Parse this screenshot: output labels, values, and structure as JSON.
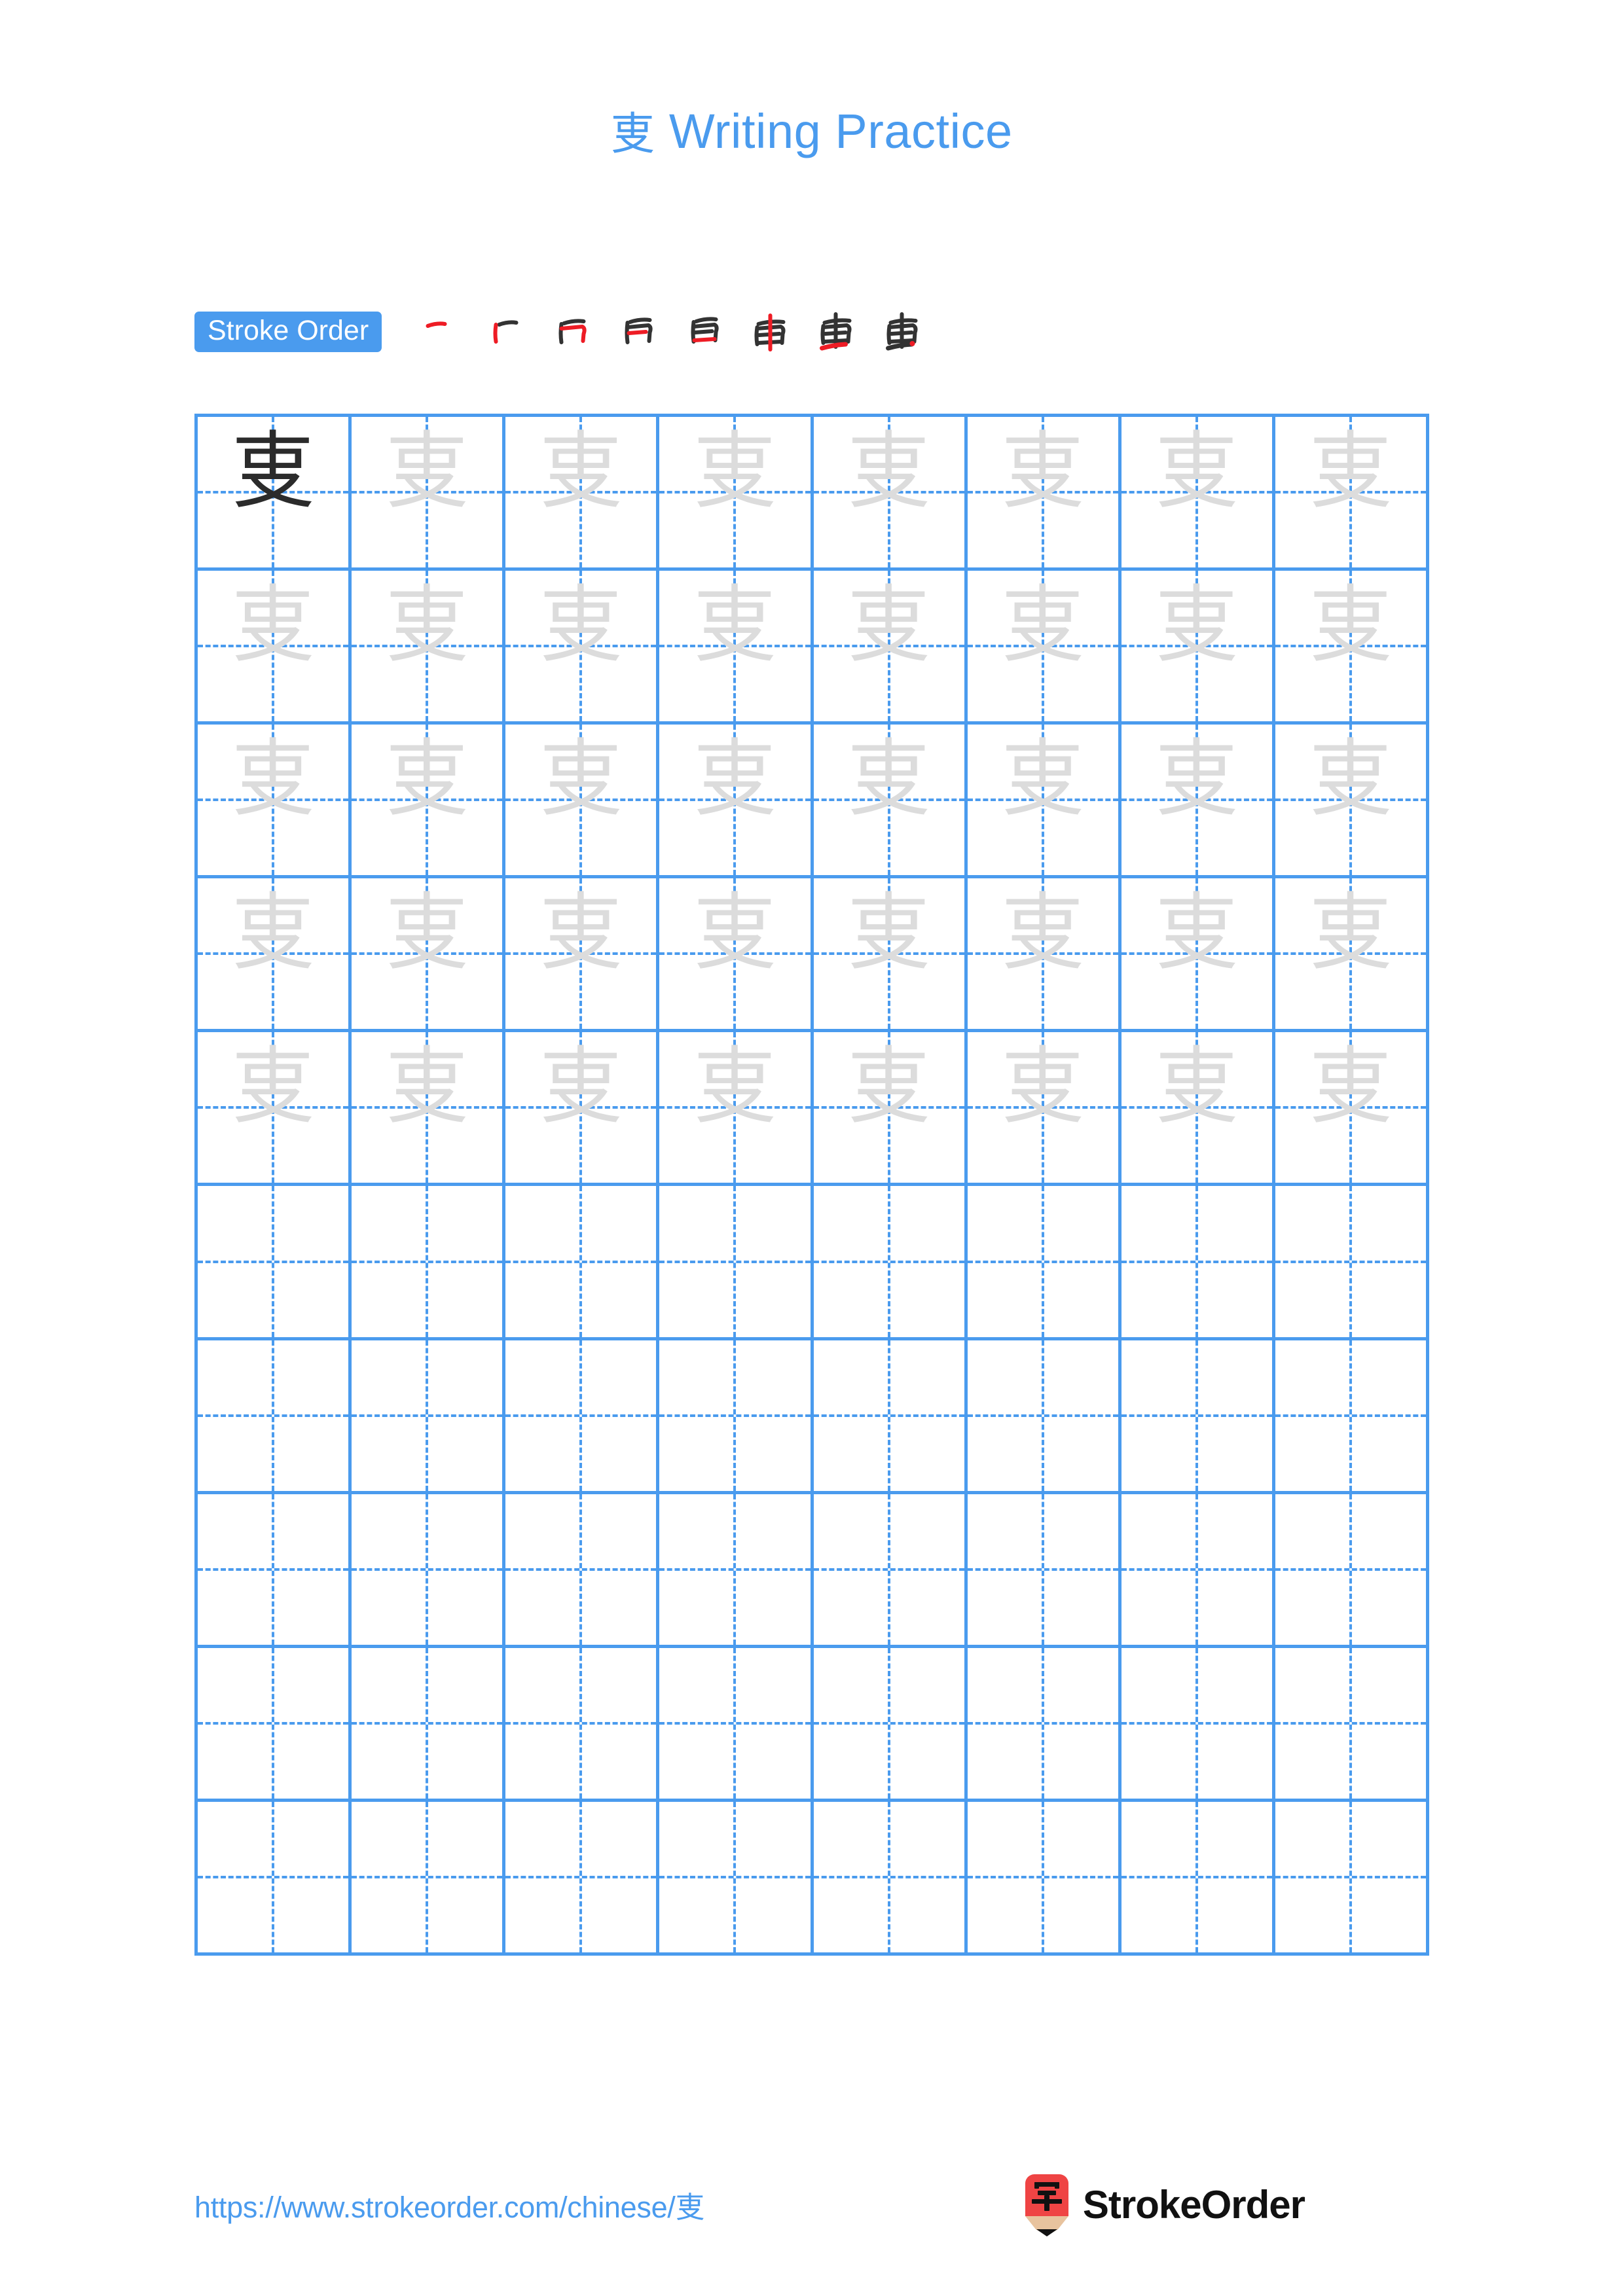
{
  "document": {
    "character": "叓",
    "title_suffix": " Writing Practice",
    "title_full": "叓 Writing Practice"
  },
  "stroke_order": {
    "badge_label": "Stroke Order",
    "badge_bg": "#4a9bee",
    "badge_text_color": "#ffffff",
    "total_strokes": 8,
    "new_stroke_color": "#ee1c25",
    "prior_stroke_color": "#333333",
    "steps": [
      {
        "index": 1,
        "label": "stroke-1"
      },
      {
        "index": 2,
        "label": "stroke-2"
      },
      {
        "index": 3,
        "label": "stroke-3"
      },
      {
        "index": 4,
        "label": "stroke-4"
      },
      {
        "index": 5,
        "label": "stroke-5"
      },
      {
        "index": 6,
        "label": "stroke-6"
      },
      {
        "index": 7,
        "label": "stroke-7"
      },
      {
        "index": 8,
        "label": "stroke-8"
      }
    ]
  },
  "grid": {
    "columns": 8,
    "rows": 10,
    "line_color": "#4a9bee",
    "guide_style": "dashed",
    "traced_color": "#dcdcdc",
    "model_color": "#2b2b2b",
    "rows_with_characters": 5,
    "empty_rows": 5,
    "model_cell": {
      "row": 1,
      "column": 1
    }
  },
  "footer": {
    "url": "https://www.strokeorder.com/chinese/叓",
    "url_color": "#4a9bee",
    "brand_name": "StrokeOrder",
    "logo_character": "字",
    "logo_body_color": "#ef4444",
    "logo_wood_color": "#e8c39e",
    "logo_tip_color": "#111111"
  }
}
